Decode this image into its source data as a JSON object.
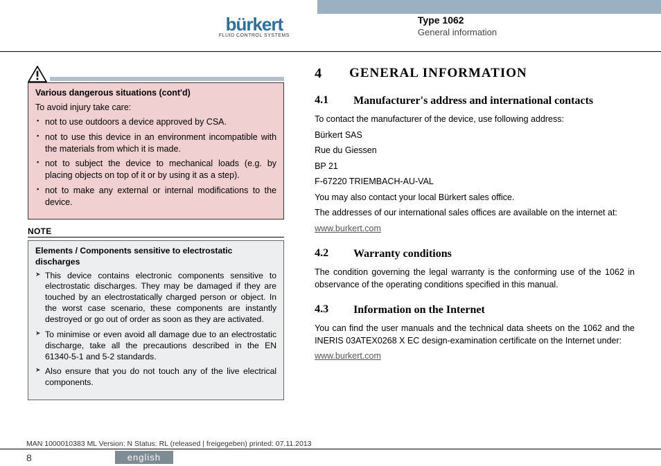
{
  "header": {
    "logo_text": "bürkert",
    "logo_subtitle": "FLUID CONTROL SYSTEMS",
    "type": "Type 1062",
    "section": "General information"
  },
  "warning": {
    "title": "Various dangerous situations (cont'd)",
    "intro": "To avoid injury take care:",
    "items": [
      "not to use outdoors a device approved by CSA.",
      "not to use this device in an environment incompatible with the materials from which it is made.",
      "not to subject the device to mechanical loads (e.g. by placing objects on top of it or by using it as a step).",
      "not to make any external or internal modifications to the device."
    ]
  },
  "note": {
    "label": "NOTE",
    "title": "Elements / Components sensitive to electrostatic discharges",
    "items": [
      "This device contains electronic components sensitive to electrostatic discharges. They may be damaged if they are touched by an electrostatically charged person or object. In the worst case scenario, these components are instantly destroyed or go out of order as soon as they are activated.",
      "To minimise or even avoid all damage due to an electrostatic discharge, take all the precautions described in the EN 61340-5-1 and 5-2 standards.",
      "Also ensure that you do not touch any of the live electrical components."
    ]
  },
  "main": {
    "h1_num": "4",
    "h1_text": "GENERAL INFORMATION",
    "s41": {
      "num": "4.1",
      "title": "Manufacturer's address and international contacts",
      "p1": "To contact the manufacturer of the device, use following address:",
      "p2": "Bürkert SAS",
      "p3": "Rue du Giessen",
      "p4": "BP 21",
      "p5": "F-67220 TRIEMBACH-AU-VAL",
      "p6": "You may also contact your local Bürkert sales office.",
      "p7": "The addresses of our international sales offices are available on the internet at:",
      "link": "www.burkert.com"
    },
    "s42": {
      "num": "4.2",
      "title": "Warranty conditions",
      "p1": "The condition governing the legal warranty is the conforming use of the 1062 in observance of the operating conditions specified in this manual."
    },
    "s43": {
      "num": "4.3",
      "title": "Information on the Internet",
      "p1": "You can find the user manuals and the technical data sheets on the 1062 and the INERIS 03ATEX0268 X EC design-examination certificate on the Internet under:",
      "link": "www.burkert.com"
    }
  },
  "footer": {
    "meta": "MAN 1000010383 ML Version: N Status: RL (released | freigegeben) printed: 07.11.2013",
    "page": "8",
    "lang": "english"
  }
}
